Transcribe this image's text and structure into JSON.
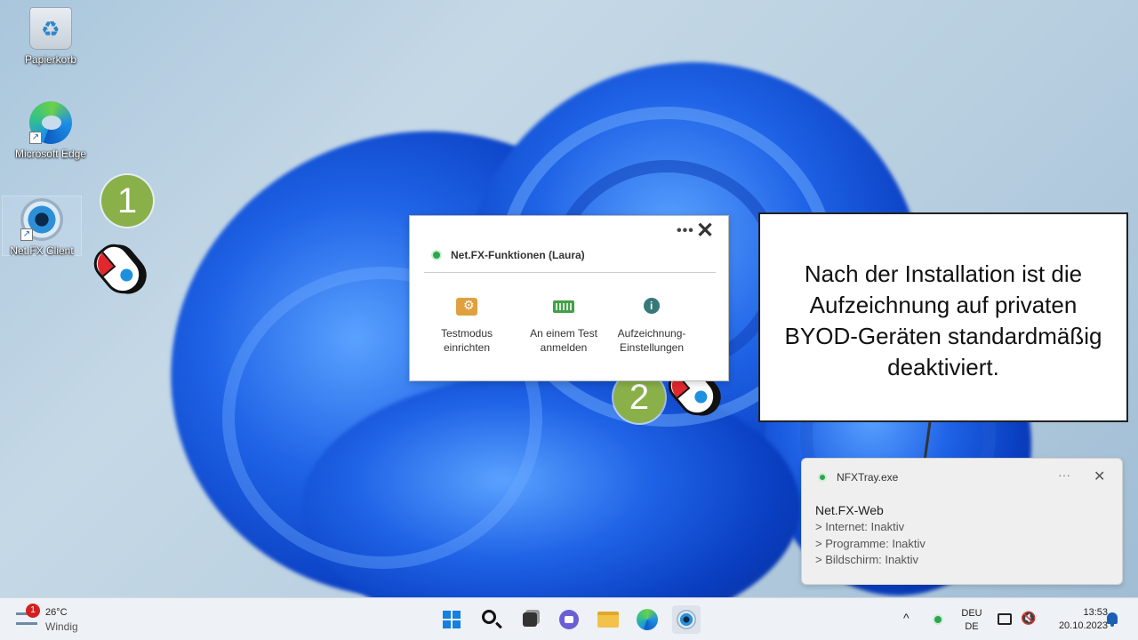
{
  "desktop": {
    "icons": [
      {
        "label": "Papierkorb",
        "icon": "recycle-bin-icon"
      },
      {
        "label": "Microsoft Edge",
        "icon": "edge-icon"
      },
      {
        "label": "Net.FX Client",
        "icon": "netfx-eye-icon"
      }
    ]
  },
  "steps": {
    "step1": "1",
    "step2": "2"
  },
  "popup": {
    "more_label": "•••",
    "close_label": "✕",
    "title": "Net.FX-Funktionen (Laura)",
    "functions": [
      {
        "label_line1": "Testmodus",
        "label_line2": "einrichten",
        "icon": "test-setup-icon"
      },
      {
        "label_line1": "An einem Test",
        "label_line2": "anmelden",
        "icon": "keyboard-icon"
      },
      {
        "label_line1": "Aufzeichnung-",
        "label_line2": "Einstellungen",
        "icon": "info-icon"
      }
    ]
  },
  "callout": {
    "line1": "Nach der Installation ist die",
    "line2": "Aufzeichnung auf privaten",
    "line3": "BYOD-Geräten standardmäßig",
    "line4": "deaktiviert."
  },
  "toast": {
    "app": "NFXTray.exe",
    "more": "···",
    "close": "✕",
    "heading": "Net.FX-Web",
    "lines": [
      "> Internet: Inaktiv",
      "> Programme: Inaktiv",
      "> Bildschirm: Inaktiv"
    ]
  },
  "taskbar": {
    "weather": {
      "badge": "1",
      "temp": "26°C",
      "condition": "Windig"
    },
    "apps": [
      "start-icon",
      "search-icon",
      "task-view-icon",
      "chat-icon",
      "file-explorer-icon",
      "edge-icon",
      "netfx-icon"
    ],
    "tray": {
      "chevron": "^",
      "lang_line1": "DEU",
      "lang_line2": "DE",
      "time": "13:53",
      "date": "20.10.2023"
    }
  },
  "colors": {
    "badge_green": "#8ab04a",
    "status_green": "#2ea44f",
    "accent_blue": "#1a5fb4"
  }
}
